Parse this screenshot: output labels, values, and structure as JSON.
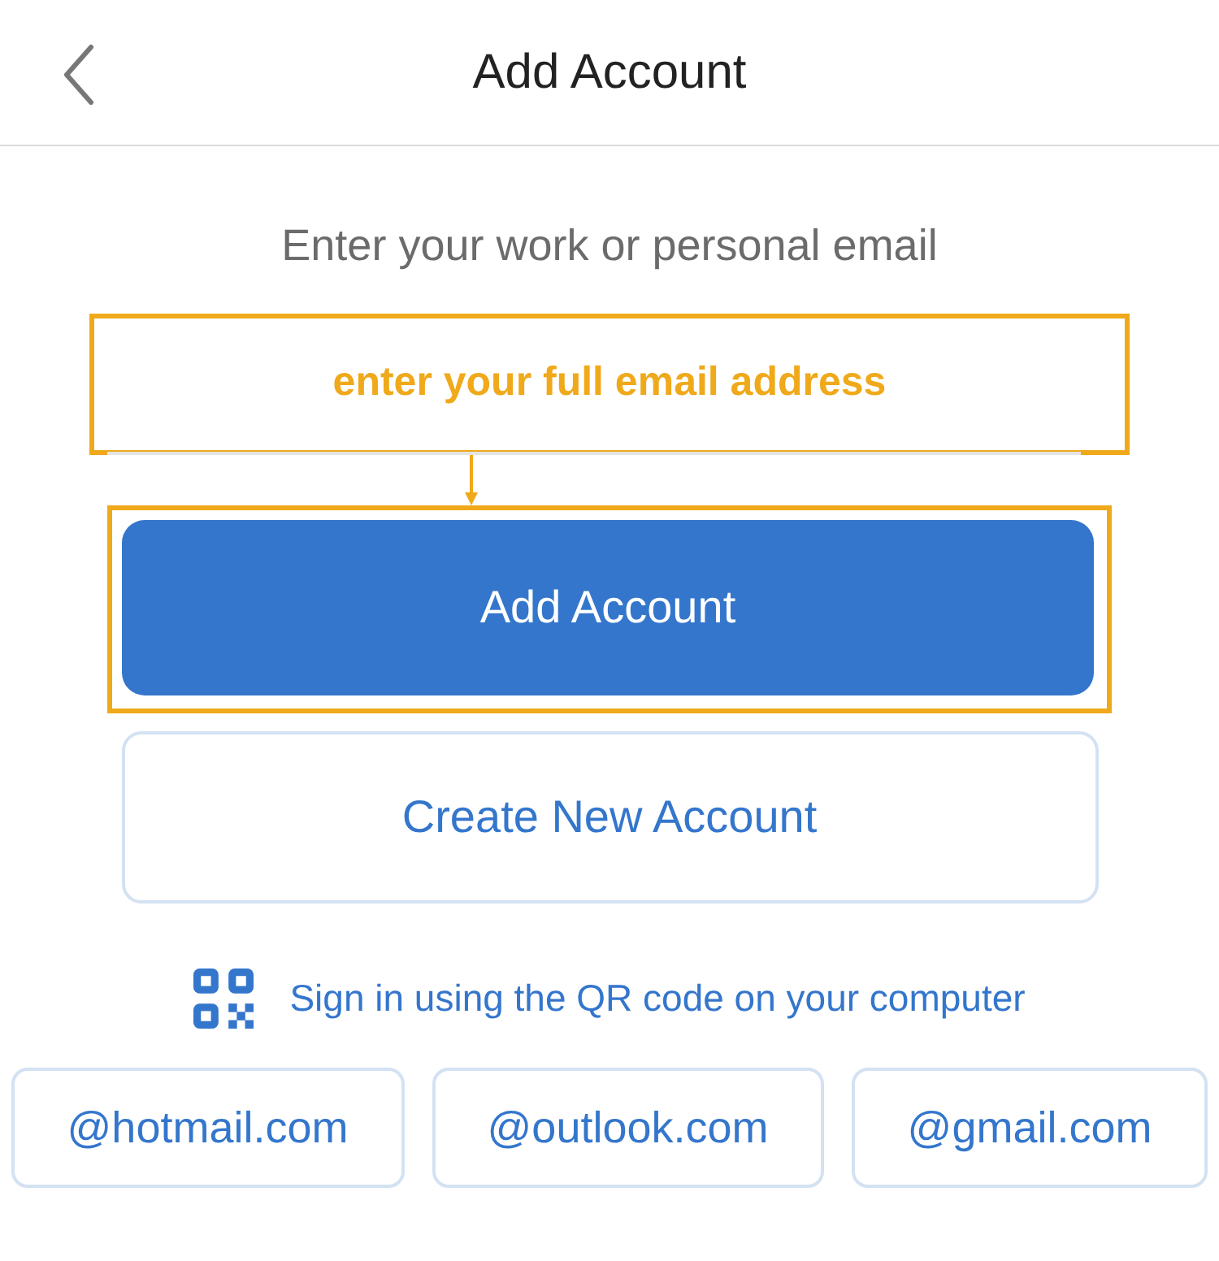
{
  "header": {
    "title": "Add Account"
  },
  "prompt": "Enter your work or personal email",
  "email_field": {
    "annotation": "enter your full email address"
  },
  "primary_button": {
    "label": "Add Account",
    "highlighted": true
  },
  "secondary_button": {
    "label": "Create New Account"
  },
  "qr_link": "Sign in using the QR code on your computer",
  "domains": [
    "@hotmail.com",
    "@outlook.com",
    "@gmail.com"
  ]
}
